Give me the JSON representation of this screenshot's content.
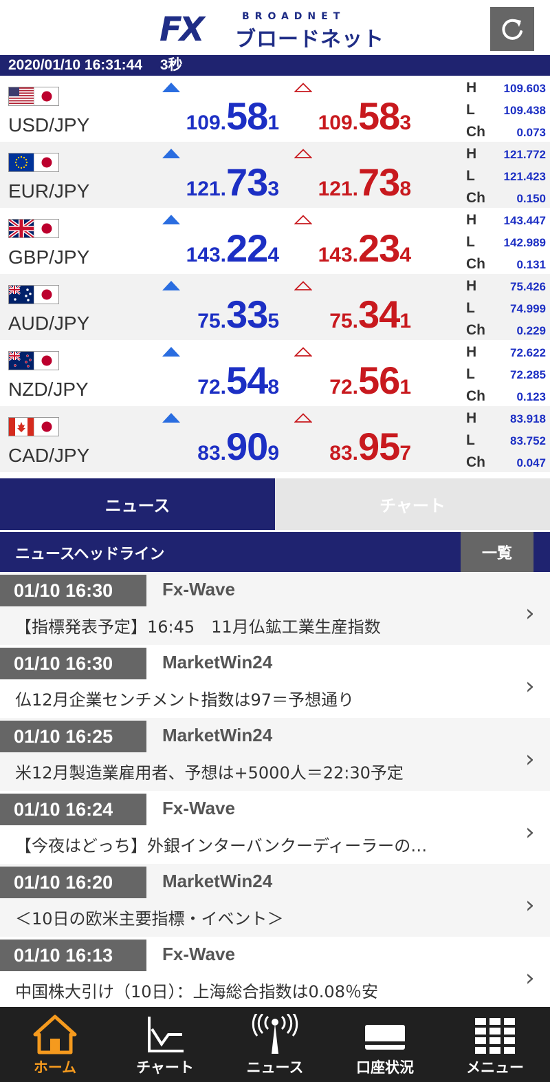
{
  "header": {
    "logo_fx": "FX",
    "logo_sub": "BROADNET",
    "logo_kana": "ブロードネット"
  },
  "status": {
    "datetime": "2020/01/10 16:31:44",
    "interval": "3秒"
  },
  "rates": [
    {
      "pair": "USD/JPY",
      "flag": "us",
      "bid_pre": "109.",
      "bid_big": "58",
      "bid_pip": "1",
      "ask_pre": "109.",
      "ask_big": "58",
      "ask_pip": "3",
      "h_label": "H",
      "h": "109.603",
      "l_label": "L",
      "l": "109.438",
      "ch_label": "Ch",
      "ch": "0.073"
    },
    {
      "pair": "EUR/JPY",
      "flag": "eu",
      "bid_pre": "121.",
      "bid_big": "73",
      "bid_pip": "3",
      "ask_pre": "121.",
      "ask_big": "73",
      "ask_pip": "8",
      "h_label": "H",
      "h": "121.772",
      "l_label": "L",
      "l": "121.423",
      "ch_label": "Ch",
      "ch": "0.150"
    },
    {
      "pair": "GBP/JPY",
      "flag": "gb",
      "bid_pre": "143.",
      "bid_big": "22",
      "bid_pip": "4",
      "ask_pre": "143.",
      "ask_big": "23",
      "ask_pip": "4",
      "h_label": "H",
      "h": "143.447",
      "l_label": "L",
      "l": "142.989",
      "ch_label": "Ch",
      "ch": "0.131"
    },
    {
      "pair": "AUD/JPY",
      "flag": "au",
      "bid_pre": "75.",
      "bid_big": "33",
      "bid_pip": "5",
      "ask_pre": "75.",
      "ask_big": "34",
      "ask_pip": "1",
      "h_label": "H",
      "h": "75.426",
      "l_label": "L",
      "l": "74.999",
      "ch_label": "Ch",
      "ch": "0.229"
    },
    {
      "pair": "NZD/JPY",
      "flag": "nz",
      "bid_pre": "72.",
      "bid_big": "54",
      "bid_pip": "8",
      "ask_pre": "72.",
      "ask_big": "56",
      "ask_pip": "1",
      "h_label": "H",
      "h": "72.622",
      "l_label": "L",
      "l": "72.285",
      "ch_label": "Ch",
      "ch": "0.123"
    },
    {
      "pair": "CAD/JPY",
      "flag": "ca",
      "bid_pre": "83.",
      "bid_big": "90",
      "bid_pip": "9",
      "ask_pre": "83.",
      "ask_big": "95",
      "ask_pip": "7",
      "h_label": "H",
      "h": "83.918",
      "l_label": "L",
      "l": "83.752",
      "ch_label": "Ch",
      "ch": "0.047"
    }
  ],
  "tabs": [
    {
      "label": "ニュース",
      "active": true
    },
    {
      "label": "チャート",
      "active": false
    }
  ],
  "news": {
    "title": "ニュースヘッドライン",
    "list_button": "一覧",
    "items": [
      {
        "time": "01/10 16:30",
        "source": "Fx-Wave",
        "headline": "【指標発表予定】16:45　11月仏鉱工業生産指数"
      },
      {
        "time": "01/10 16:30",
        "source": "MarketWin24",
        "headline": "仏12月企業センチメント指数は97＝予想通り"
      },
      {
        "time": "01/10 16:25",
        "source": "MarketWin24",
        "headline": "米12月製造業雇用者、予想は+5000人＝22:30予定"
      },
      {
        "time": "01/10 16:24",
        "source": "Fx-Wave",
        "headline": "【今夜はどっち】外銀インターバンクーディーラーの…"
      },
      {
        "time": "01/10 16:20",
        "source": "MarketWin24",
        "headline": "＜10日の欧米主要指標・イベント＞"
      },
      {
        "time": "01/10 16:13",
        "source": "Fx-Wave",
        "headline": "中国株大引け（10日）：上海総合指数は0.08％安"
      }
    ]
  },
  "nav": [
    {
      "label": "ホーム",
      "icon": "home-icon",
      "active": true
    },
    {
      "label": "チャート",
      "icon": "chart-icon",
      "active": false
    },
    {
      "label": "ニュース",
      "icon": "broadcast-icon",
      "active": false
    },
    {
      "label": "口座状況",
      "icon": "card-icon",
      "active": false
    },
    {
      "label": "メニュー",
      "icon": "grid-menu-icon",
      "active": false
    }
  ],
  "colors": {
    "navy": "#1f2370",
    "bid_blue": "#1c2fc4",
    "ask_red": "#c8191e",
    "active_orange": "#f59a1e"
  }
}
